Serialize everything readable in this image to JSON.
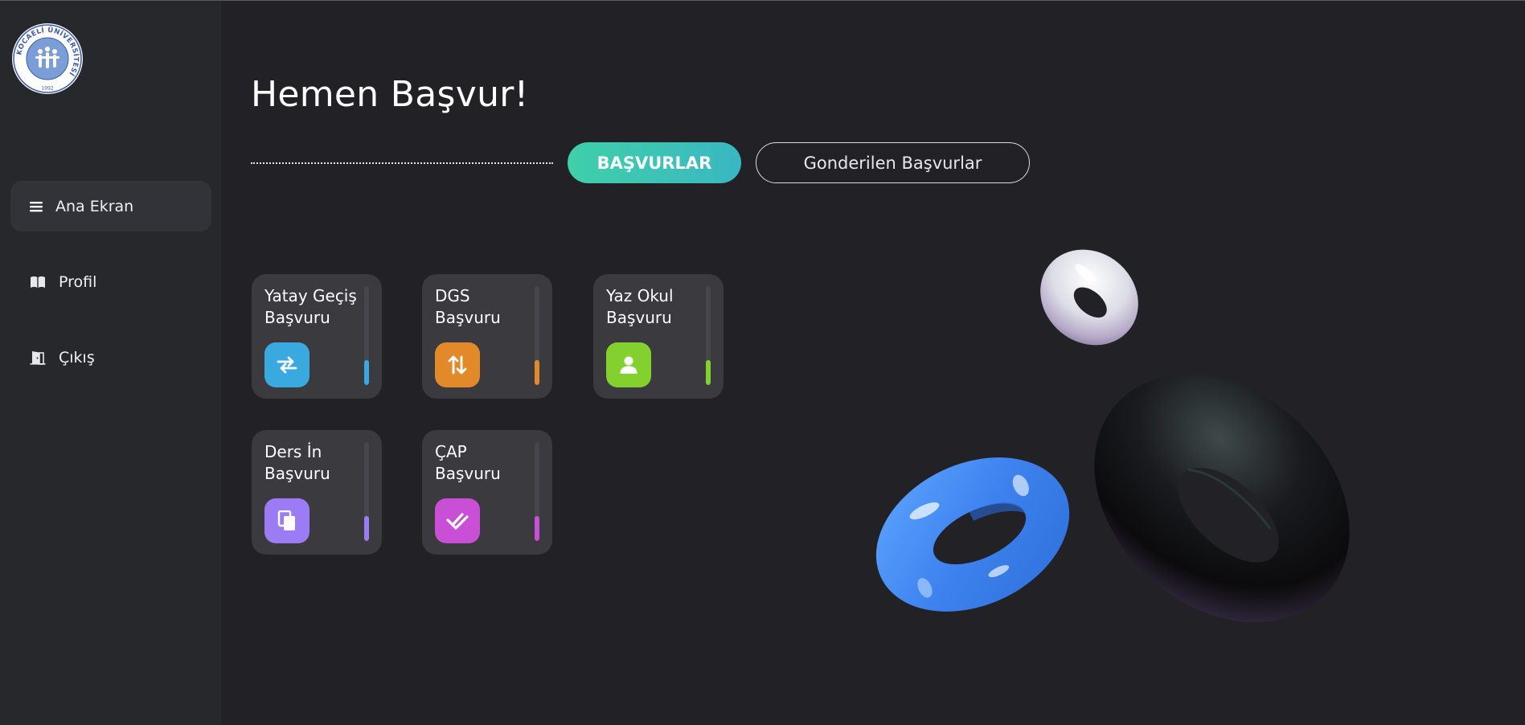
{
  "logo": {
    "ring_text": "KOCAELİ ÜNİVERSİTESİ",
    "year": "1992"
  },
  "sidebar": {
    "items": [
      {
        "label": "Ana Ekran",
        "icon": "menu-icon",
        "active": true
      },
      {
        "label": "Profil",
        "icon": "book-icon",
        "active": false
      },
      {
        "label": "Çıkış",
        "icon": "exit-door-icon",
        "active": false
      }
    ]
  },
  "main": {
    "title": "Hemen Başvur!",
    "tabs": [
      {
        "label": "BAŞVURLAR",
        "active": true
      },
      {
        "label": "Gonderilen Başvurlar",
        "active": false
      }
    ],
    "cards": [
      {
        "title": "Yatay Geçiş Başvuru",
        "icon": "swap-arrows-icon",
        "color": "#3aa9e0",
        "level": 0.25
      },
      {
        "title": "DGS Başvuru",
        "icon": "sort-arrows-icon",
        "color": "#e2892a",
        "level": 0.25
      },
      {
        "title": "Yaz Okul Başvuru",
        "icon": "user-icon",
        "color": "#82d12e",
        "level": 0.25
      },
      {
        "title": "Ders İn Başvuru",
        "icon": "copy-icon",
        "color": "#9b7cf5",
        "level": 0.25
      },
      {
        "title": "ÇAP Başvuru",
        "icon": "double-check-icon",
        "color": "#c94fd6",
        "level": 0.25
      }
    ]
  },
  "colors": {
    "background": "#212126",
    "sidebar": "#27282c",
    "accent": "#3fd0a9"
  }
}
